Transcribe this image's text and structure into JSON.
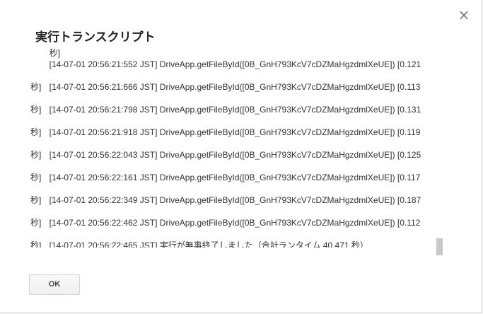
{
  "dialog": {
    "title": "実行トランスクリプト",
    "close_glyph": "×",
    "ok_label": "OK"
  },
  "log": {
    "top_fragment": "秒]",
    "entries": [
      {
        "line1": "[14-07-01 20:56:21:552 JST] DriveApp.getFileById([0B_GnH793KcV7cDZMaHgzdmlXeUE]) [0.121",
        "line2": "秒]"
      },
      {
        "line1": "[14-07-01 20:56:21:666 JST] DriveApp.getFileById([0B_GnH793KcV7cDZMaHgzdmlXeUE]) [0.113",
        "line2": "秒]"
      },
      {
        "line1": "[14-07-01 20:56:21:798 JST] DriveApp.getFileById([0B_GnH793KcV7cDZMaHgzdmlXeUE]) [0.131",
        "line2": "秒]"
      },
      {
        "line1": "[14-07-01 20:56:21:918 JST] DriveApp.getFileById([0B_GnH793KcV7cDZMaHgzdmlXeUE]) [0.119",
        "line2": "秒]"
      },
      {
        "line1": "[14-07-01 20:56:22:043 JST] DriveApp.getFileById([0B_GnH793KcV7cDZMaHgzdmlXeUE]) [0.125",
        "line2": "秒]"
      },
      {
        "line1": "[14-07-01 20:56:22:161 JST] DriveApp.getFileById([0B_GnH793KcV7cDZMaHgzdmlXeUE]) [0.117",
        "line2": "秒]"
      },
      {
        "line1": "[14-07-01 20:56:22:349 JST] DriveApp.getFileById([0B_GnH793KcV7cDZMaHgzdmlXeUE]) [0.187",
        "line2": "秒]"
      },
      {
        "line1": "[14-07-01 20:56:22:462 JST] DriveApp.getFileById([0B_GnH793KcV7cDZMaHgzdmlXeUE]) [0.112",
        "line2": "秒]"
      }
    ],
    "final_line": "[14-07-01 20:56:22:465 JST] 実行が無事終了しました（合計ランタイム 40.471 秒）"
  }
}
